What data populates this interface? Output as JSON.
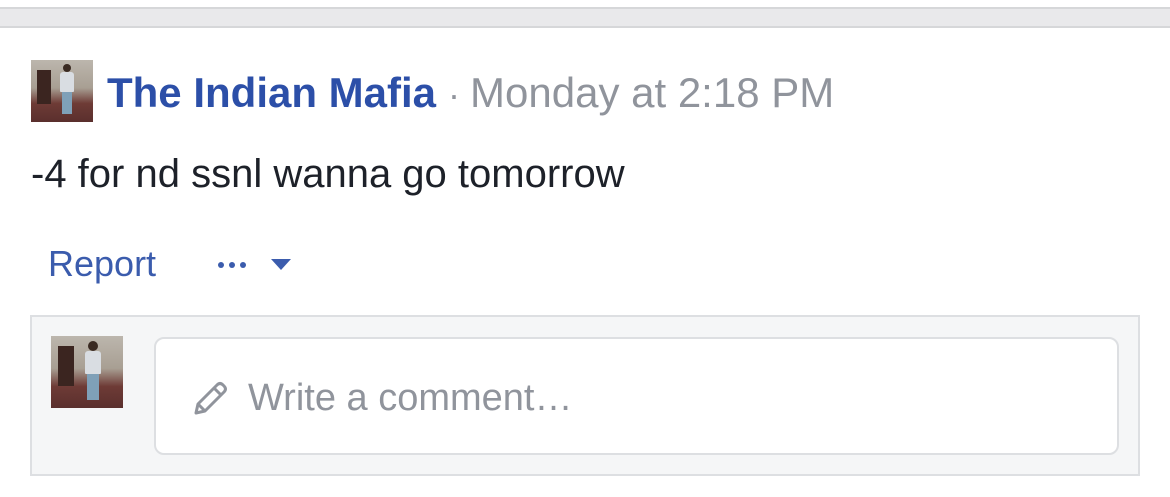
{
  "post": {
    "author_name": "The Indian Mafia",
    "separator": "·",
    "timestamp": "Monday at 2:18 PM",
    "text": "-4 for nd ssnl wanna go tomorrow"
  },
  "actions": {
    "report_label": "Report",
    "more_icon": "ellipsis-icon",
    "dropdown_icon": "caret-down-icon"
  },
  "comment": {
    "placeholder": "Write a comment…",
    "icon": "pencil-icon"
  },
  "colors": {
    "link_blue": "#3b5cad",
    "name_blue": "#2c4fa8",
    "muted_gray": "#90949c",
    "text_dark": "#1d2129",
    "comment_bg": "#f5f6f7",
    "border": "#dddfe2"
  }
}
